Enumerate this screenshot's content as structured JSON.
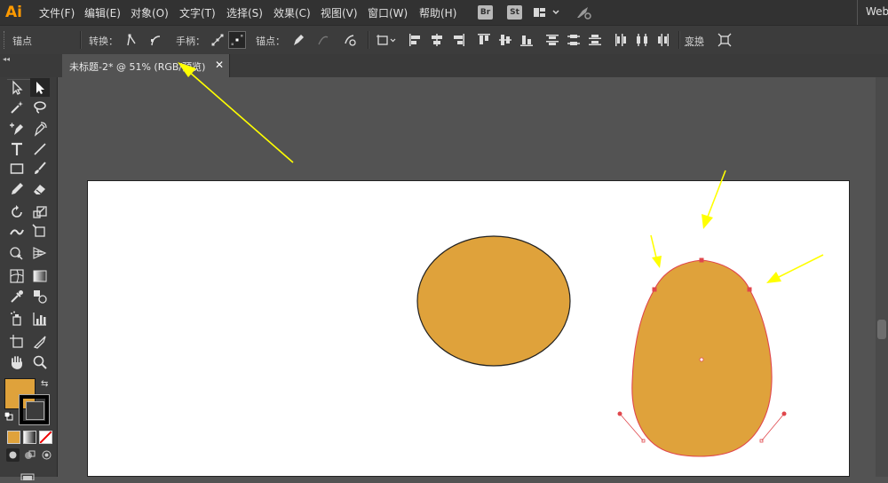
{
  "app": {
    "logo": "Ai"
  },
  "menubar": {
    "items": [
      {
        "label": "文件(F)"
      },
      {
        "label": "编辑(E)"
      },
      {
        "label": "对象(O)"
      },
      {
        "label": "文字(T)"
      },
      {
        "label": "选择(S)"
      },
      {
        "label": "效果(C)"
      },
      {
        "label": "视图(V)"
      },
      {
        "label": "窗口(W)"
      },
      {
        "label": "帮助(H)"
      }
    ],
    "bridge": "Br",
    "stock": "St",
    "workspace": "Web"
  },
  "controlbar": {
    "selection_type": "锚点",
    "convert_label": "转换：",
    "handles_label": "手柄：",
    "anchors_label": "锚点：",
    "transform_label": "变换"
  },
  "document": {
    "tab_title": "未标题-2* @ 51% (RGB/预览)",
    "close_glyph": "✕"
  },
  "colors": {
    "fill": "#dfa23b",
    "stroke": "#000000",
    "selection": "#e0474c",
    "arrow": "#ffff00"
  }
}
